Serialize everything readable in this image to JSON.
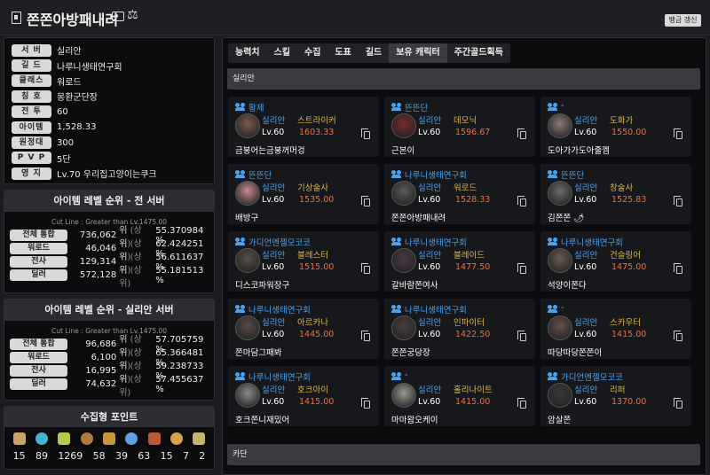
{
  "header": {
    "title": "쫀쫀아방패내려",
    "renew_button": "뱅금 갱신"
  },
  "profile": [
    {
      "label": "서 버",
      "value": "실리안"
    },
    {
      "label": "길 드",
      "value": "나루니생태연구회"
    },
    {
      "label": "클래스",
      "value": "워로드"
    },
    {
      "label": "칭 호",
      "value": "몽환군단장"
    },
    {
      "label": "전 투",
      "value": "60"
    },
    {
      "label": "아이템",
      "value": "1,528.33"
    },
    {
      "label": "원정대",
      "value": "300"
    },
    {
      "label": "P V P",
      "value": "5단"
    },
    {
      "label": "영 지",
      "value": "Lv.70 우리집고양이는쿠크"
    }
  ],
  "rank_all": {
    "title": "아이템 레벨 순위 - 전 서버",
    "cutline": "Cut Line : Greater than Lv.1475.00",
    "rows": [
      {
        "label": "전체 통합",
        "rank": "736,062",
        "unit": "위",
        "paren": "(상위)",
        "pct": "55.370984 %"
      },
      {
        "label": "워로드",
        "rank": "46,046",
        "unit": "위",
        "paren": "(상위)",
        "pct": "62.424251 %"
      },
      {
        "label": "전사",
        "rank": "129,314",
        "unit": "위",
        "paren": "(상위)",
        "pct": "56.611637 %"
      },
      {
        "label": "딜러",
        "rank": "572,128",
        "unit": "위",
        "paren": "(상위)",
        "pct": "55.181513 %"
      }
    ]
  },
  "rank_server": {
    "title": "아이템 레벨 순위 - 실리안 서버",
    "cutline": "Cut Line : Greater than Lv.1475.00",
    "rows": [
      {
        "label": "전체 통합",
        "rank": "96,686",
        "unit": "위",
        "paren": "(상위)",
        "pct": "57.705759 %"
      },
      {
        "label": "워로드",
        "rank": "6,100",
        "unit": "위",
        "paren": "(상위)",
        "pct": "65.366481 %"
      },
      {
        "label": "전사",
        "rank": "16,995",
        "unit": "위",
        "paren": "(상위)",
        "pct": "59.238733 %"
      },
      {
        "label": "딜러",
        "rank": "74,632",
        "unit": "위",
        "paren": "(상위)",
        "pct": "57.455637 %"
      }
    ]
  },
  "collect": {
    "title": "수집형 포인트",
    "items": [
      {
        "icon": "mokoko-seed-icon",
        "count": "15",
        "color": "#c9a36a"
      },
      {
        "icon": "island-heart-icon",
        "count": "89",
        "color": "#3fb6c9"
      },
      {
        "icon": "ignea-token-icon",
        "count": "1269",
        "color": "#b7c94a"
      },
      {
        "icon": "art-icon",
        "count": "58",
        "color": "#b07a3e"
      },
      {
        "icon": "voyage-icon",
        "count": "39",
        "color": "#c8963a"
      },
      {
        "icon": "world-tree-leaf-icon",
        "count": "63",
        "color": "#5ea0e0"
      },
      {
        "icon": "giant-heart-icon",
        "count": "15",
        "color": "#b85a3a"
      },
      {
        "icon": "orpheus-star-icon",
        "count": "7",
        "color": "#d9a24a"
      },
      {
        "icon": "sea-bounty-icon",
        "count": "2",
        "color": "#c9b36a"
      }
    ]
  },
  "tabs": [
    "능력치",
    "스킬",
    "수집",
    "도표",
    "길드",
    "보유 캐릭터",
    "주간골드획득"
  ],
  "active_tab": 5,
  "sections": [
    {
      "server": "실리안"
    },
    {
      "server": "카단"
    }
  ],
  "characters": [
    {
      "guild": "황제",
      "server": "실리안",
      "class": "스트라이커",
      "level": "Lv.60",
      "ilvl": "1603.33",
      "name": "금붕어는금붕꺼머겅",
      "avatar": "#7a5a4a"
    },
    {
      "guild": "뜬뜬단",
      "server": "실리안",
      "class": "데모닉",
      "level": "Lv.60",
      "ilvl": "1596.67",
      "name": "근본이",
      "avatar": "#7a2a2a"
    },
    {
      "guild": "-",
      "server": "실리안",
      "class": "도화가",
      "level": "Lv.60",
      "ilvl": "1550.00",
      "name": "도아가가도아줄껨",
      "avatar": "#8a7a78"
    },
    {
      "guild": "뜬뜬단",
      "server": "실리안",
      "class": "기상술사",
      "level": "Lv.60",
      "ilvl": "1535.00",
      "name": "배방구",
      "avatar": "#c98a8e"
    },
    {
      "guild": "나루니생태연구회",
      "server": "실리안",
      "class": "워로드",
      "level": "Lv.60",
      "ilvl": "1528.33",
      "name": "쫀쫀아방패내려",
      "avatar": "#5a5a5a"
    },
    {
      "guild": "뜬뜬단",
      "server": "실리안",
      "class": "창술사",
      "level": "Lv.60",
      "ilvl": "1525.83",
      "name": "김쫀쫀 🌶",
      "avatar": "#6a6a6a"
    },
    {
      "guild": "가디언엔젤모코코",
      "server": "실리안",
      "class": "블레스터",
      "level": "Lv.60",
      "ilvl": "1515.00",
      "name": "디스코파워장구",
      "avatar": "#5a5048"
    },
    {
      "guild": "나루니생태연구회",
      "server": "실리안",
      "class": "블레이드",
      "level": "Lv.60",
      "ilvl": "1477.50",
      "name": "갈바람쫀여사",
      "avatar": "#4a3a4a"
    },
    {
      "guild": "나루니생태연구회",
      "server": "실리안",
      "class": "건슬링어",
      "level": "Lv.60",
      "ilvl": "1475.00",
      "name": "석양이쫀다",
      "avatar": "#6a5a50"
    },
    {
      "guild": "나루니생태연구회",
      "server": "실리안",
      "class": "아르카나",
      "level": "Lv.60",
      "ilvl": "1445.00",
      "name": "쫀마담그패봐",
      "avatar": "#5a4a48"
    },
    {
      "guild": "나루니생태연구회",
      "server": "실리안",
      "class": "인파이터",
      "level": "Lv.60",
      "ilvl": "1422.50",
      "name": "쫀쫀궁당장",
      "avatar": "#4a4040"
    },
    {
      "guild": "-",
      "server": "실리안",
      "class": "스카우터",
      "level": "Lv.60",
      "ilvl": "1415.00",
      "name": "따당따당쫀쫀이",
      "avatar": "#6a5048"
    },
    {
      "guild": "나루니생태연구회",
      "server": "실리안",
      "class": "호크아이",
      "level": "Lv.60",
      "ilvl": "1415.00",
      "name": "호크쫀니재밌어",
      "avatar": "#8a8a88"
    },
    {
      "guild": "-",
      "server": "실리안",
      "class": "홀리나이트",
      "level": "Lv.60",
      "ilvl": "1415.00",
      "name": "마마왐오케이",
      "avatar": "#9a9a90"
    },
    {
      "guild": "가디언엔젤모코코",
      "server": "실리안",
      "class": "리퍼",
      "level": "Lv.60",
      "ilvl": "1370.00",
      "name": "암살쫀",
      "avatar": "#3a3a3a"
    }
  ]
}
